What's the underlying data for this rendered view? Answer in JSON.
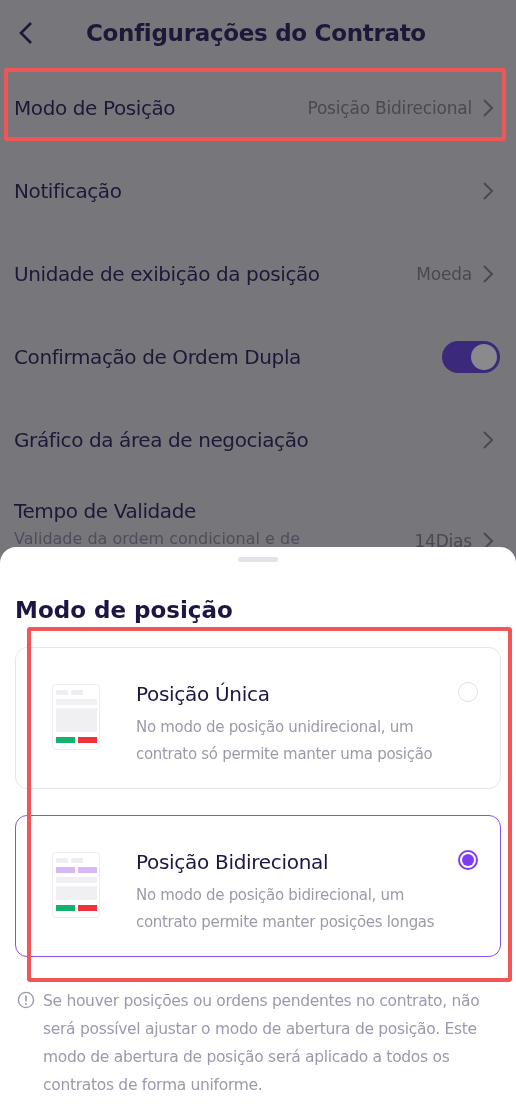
{
  "header": {
    "title": "Configurações do Contrato"
  },
  "settings": [
    {
      "kind": "link",
      "label": "Modo de Posição",
      "value": "Posição Bidirecional",
      "highlighted": true
    },
    {
      "kind": "link",
      "label": "Notificação",
      "highlighted": false
    },
    {
      "kind": "link",
      "label": "Unidade de exibição da posição",
      "value": "Moeda",
      "highlighted": false
    },
    {
      "kind": "toggle",
      "label": "Confirmação de Ordem Dupla",
      "on": true,
      "highlighted": false
    },
    {
      "kind": "link",
      "label": "Gráfico da área de negociação",
      "highlighted": false
    },
    {
      "kind": "link",
      "label": "Tempo de Validade",
      "sublabel": "Validade da ordem condicional e de",
      "value": "14Dias",
      "highlighted": false
    }
  ],
  "sheet": {
    "title": "Modo de posição",
    "options_highlighted": true,
    "options": [
      {
        "title": "Posição Única",
        "description": "No modo de posição unidirecional, um contrato só permite manter uma posição",
        "selected": false,
        "kind": "single"
      },
      {
        "title": "Posição Bidirecional",
        "description": "No modo de posição bidirecional, um contrato permite manter posições longas",
        "selected": true,
        "kind": "dual"
      }
    ],
    "note": "Se houver posições ou ordens pendentes no contrato, não será possível ajustar o modo de abertura de posição. Este modo de abertura de posição será aplicado a todos os contratos de forma uniforme."
  }
}
